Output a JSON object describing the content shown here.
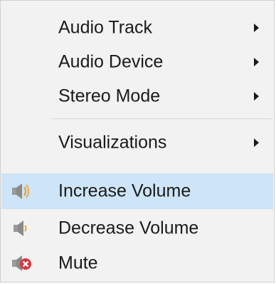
{
  "menu": {
    "items": [
      {
        "label": "Audio Track",
        "submenu": true
      },
      {
        "label": "Audio Device",
        "submenu": true
      },
      {
        "label": "Stereo Mode",
        "submenu": true
      },
      {
        "label": "Visualizations",
        "submenu": true
      },
      {
        "label": "Increase Volume",
        "icon": "volume-up-icon",
        "highlighted": true
      },
      {
        "label": "Decrease Volume",
        "icon": "volume-down-icon"
      },
      {
        "label": "Mute",
        "icon": "mute-icon"
      }
    ]
  },
  "colors": {
    "background": "#f2f2f2",
    "highlight": "#cde5f7",
    "separator": "#d6d6d6",
    "text": "#1a1a1a",
    "mute_red": "#d9363e"
  }
}
